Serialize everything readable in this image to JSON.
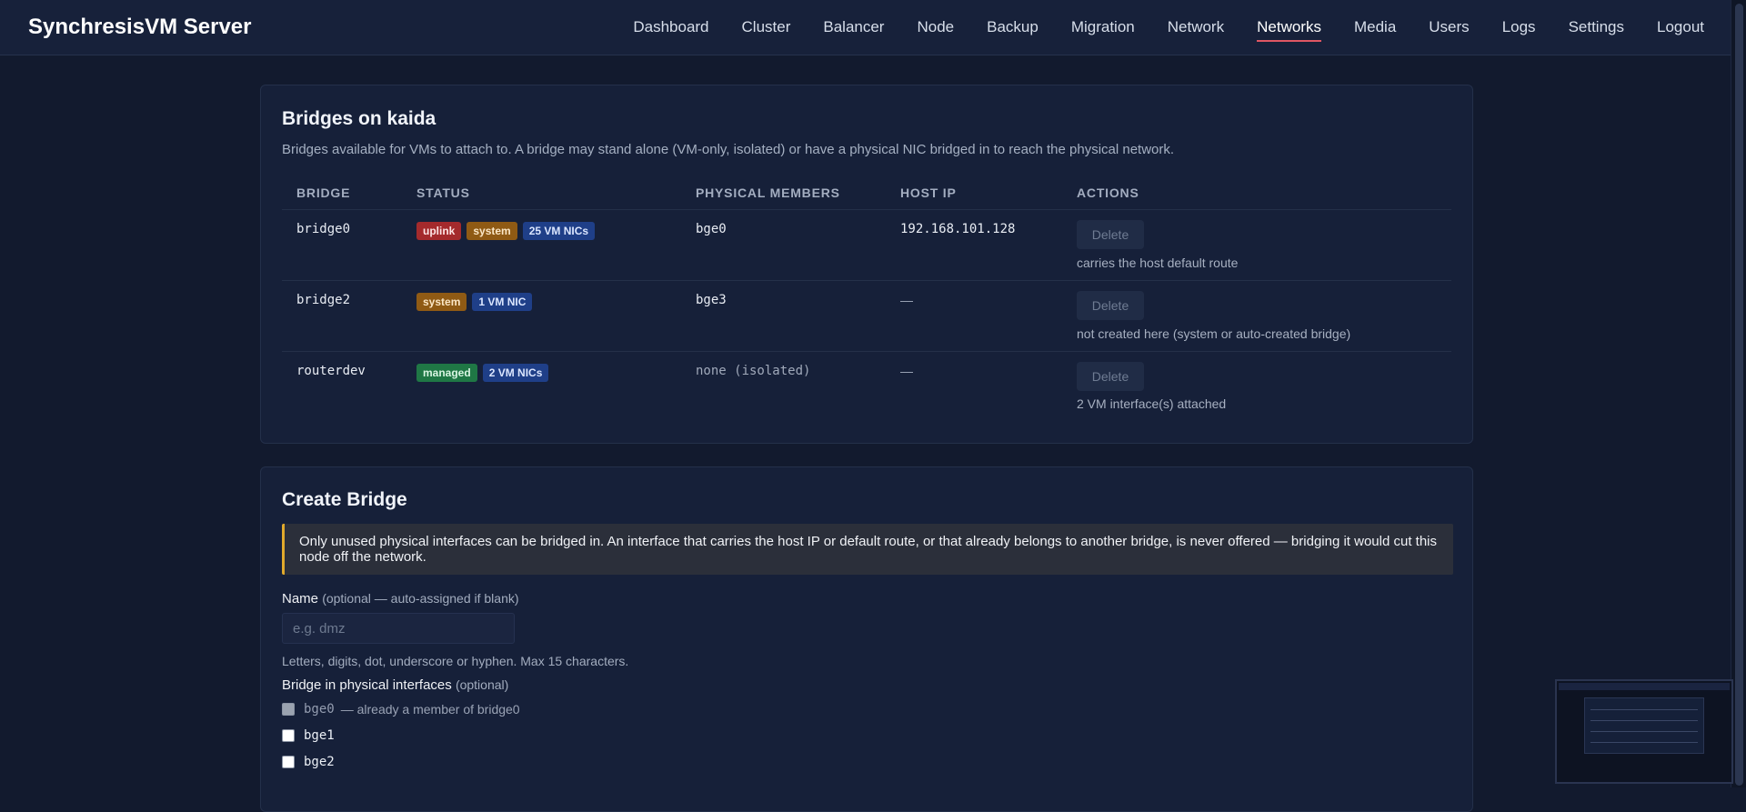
{
  "app": {
    "title": "SynchresisVM Server"
  },
  "nav": {
    "items": [
      "Dashboard",
      "Cluster",
      "Balancer",
      "Node",
      "Backup",
      "Migration",
      "Network",
      "Networks",
      "Media",
      "Users",
      "Logs",
      "Settings",
      "Logout"
    ],
    "active": "Networks"
  },
  "bridges": {
    "title": "Bridges on kaida",
    "description": "Bridges available for VMs to attach to. A bridge may stand alone (VM-only, isolated) or have a physical NIC bridged in to reach the physical network.",
    "columns": [
      "BRIDGE",
      "STATUS",
      "PHYSICAL MEMBERS",
      "HOST IP",
      "ACTIONS"
    ],
    "rows": [
      {
        "name": "bridge0",
        "badges": [
          "uplink",
          "system",
          "25 VM NICs"
        ],
        "members": "bge0",
        "host_ip": "192.168.101.128",
        "action": "Delete",
        "note": "carries the host default route"
      },
      {
        "name": "bridge2",
        "badges": [
          "system",
          "1 VM NIC"
        ],
        "members": "bge3",
        "host_ip": "—",
        "action": "Delete",
        "note": "not created here (system or auto-created bridge)"
      },
      {
        "name": "routerdev",
        "badges": [
          "managed",
          "2 VM NICs"
        ],
        "members": "none (isolated)",
        "host_ip": "—",
        "action": "Delete",
        "note": "2 VM interface(s) attached"
      }
    ]
  },
  "create": {
    "title": "Create Bridge",
    "alert": "Only unused physical interfaces can be bridged in. An interface that carries the host IP or default route, or that already belongs to another bridge, is never offered — bridging it would cut this node off the network.",
    "name_label": "Name",
    "name_hint": "(optional — auto-assigned if blank)",
    "name_placeholder": "e.g. dmz",
    "name_help": "Letters, digits, dot, underscore or hyphen. Max 15 characters.",
    "phys_label": "Bridge in physical interfaces",
    "phys_hint": "(optional)",
    "interfaces": [
      {
        "name": "bge0",
        "note": "— already a member of bridge0",
        "disabled": true
      },
      {
        "name": "bge1",
        "note": "",
        "disabled": false
      },
      {
        "name": "bge2",
        "note": "",
        "disabled": false
      }
    ]
  },
  "colors": {
    "accent": "#e05663",
    "warning": "#e0a92c",
    "background": "#121a2e"
  }
}
